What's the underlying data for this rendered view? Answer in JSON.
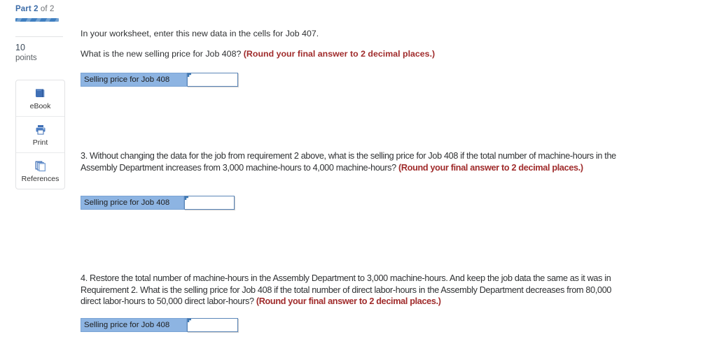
{
  "sidebar": {
    "part_label_strong": "Part 2",
    "part_label_rest": " of 2",
    "points_value": "10",
    "points_label": "points",
    "tools": [
      {
        "label": "eBook",
        "icon": "book-icon"
      },
      {
        "label": "Print",
        "icon": "printer-icon"
      },
      {
        "label": "References",
        "icon": "pages-stack-icon"
      }
    ]
  },
  "content": {
    "intro_line": "In your worksheet, enter this new data in the cells for Job 407.",
    "q2": {
      "text": "What is the new selling price for Job 408? ",
      "emphasis": "(Round your final answer to 2 decimal places.)"
    },
    "q3": {
      "text": "3. Without changing the data for the job from requirement 2 above, what is the selling price for Job 408 if the total number of machine-hours in the Assembly Department increases from 3,000 machine-hours to 4,000 machine-hours? ",
      "emphasis": "(Round your final answer to 2 decimal places.)"
    },
    "q4": {
      "text": "4. Restore the total number of machine-hours in the Assembly Department to 3,000 machine-hours. And keep the job data the same as it was in Requirement 2. What is the selling price for Job 408 if the total number of direct labor-hours in the Assembly Department decreases from 80,000 direct labor-hours to 50,000 direct labor-hours? ",
      "emphasis": "(Round your final answer to 2 decimal places.)"
    },
    "answers": [
      {
        "label": "Selling price for Job 408",
        "value": "",
        "placeholder": ""
      },
      {
        "label": "Selling price for Job 408",
        "value": "",
        "placeholder": ""
      },
      {
        "label": "Selling price for Job 408",
        "value": "",
        "placeholder": ""
      }
    ]
  },
  "colors": {
    "accent_blue": "#3f7fc1",
    "cell_blue": "#8db4e2",
    "emphasis_red": "#a02c2c"
  }
}
